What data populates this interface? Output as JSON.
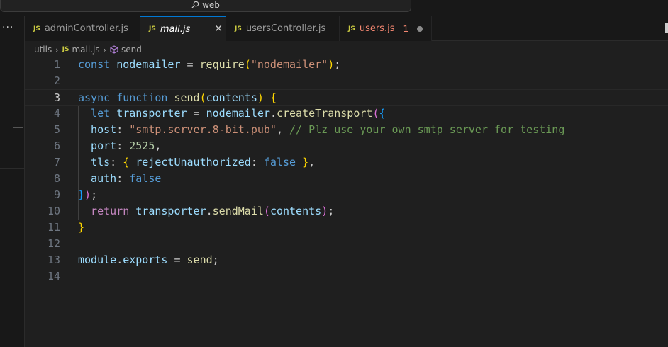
{
  "titlebar": {
    "search_text": "web"
  },
  "activity": {
    "more": "···"
  },
  "tabs": [
    {
      "label": "adminController.js",
      "icon": "JS",
      "italic": false,
      "modified": true,
      "active": false
    },
    {
      "label": "mail.js",
      "icon": "JS",
      "italic": true,
      "modified": false,
      "active": true,
      "close": "✕"
    },
    {
      "label": "usersController.js",
      "icon": "JS",
      "italic": false,
      "modified": false,
      "active": false
    },
    {
      "label": "users.js",
      "icon": "JS",
      "italic": false,
      "modified": true,
      "active": false,
      "problems": "1",
      "error": true
    }
  ],
  "breadcrumb": {
    "folder": "utils",
    "file": "mail.js",
    "symbol": "send",
    "icon": "JS"
  },
  "editor": {
    "line_numbers": [
      "1",
      "2",
      "3",
      "4",
      "5",
      "6",
      "7",
      "8",
      "9",
      "10",
      "11",
      "12",
      "13",
      "14"
    ],
    "current_line": 3,
    "tokens": [
      [
        [
          "const ",
          "kw"
        ],
        [
          "nodemailer",
          "var"
        ],
        [
          " = ",
          ""
        ],
        [
          "require",
          "fn"
        ],
        [
          "(",
          "p1"
        ],
        [
          "\"nodemailer\"",
          "str"
        ],
        [
          ")",
          "p1"
        ],
        [
          ";",
          ""
        ]
      ],
      [],
      [
        [
          "async ",
          "kw"
        ],
        [
          "function ",
          "kw"
        ],
        [
          "|",
          ""
        ],
        [
          "send",
          "fn"
        ],
        [
          "(",
          "p1"
        ],
        [
          "contents",
          "var"
        ],
        [
          ")",
          "p1"
        ],
        [
          " ",
          ""
        ],
        [
          "{",
          "p1"
        ]
      ],
      [
        [
          "  let ",
          "kw"
        ],
        [
          "transporter",
          "var"
        ],
        [
          " = ",
          ""
        ],
        [
          "nodemailer",
          "var"
        ],
        [
          ".",
          ""
        ],
        [
          "createTransport",
          "fn"
        ],
        [
          "(",
          "p2"
        ],
        [
          "{",
          "p3"
        ]
      ],
      [
        [
          "  host",
          "var"
        ],
        [
          ": ",
          ""
        ],
        [
          "\"smtp.server.8-bit.pub\"",
          "str"
        ],
        [
          ", ",
          ""
        ],
        [
          "// Plz use your own smtp server for testing",
          "com"
        ]
      ],
      [
        [
          "  port",
          "var"
        ],
        [
          ": ",
          ""
        ],
        [
          "2525",
          "num"
        ],
        [
          ",",
          ""
        ]
      ],
      [
        [
          "  tls",
          "var"
        ],
        [
          ": ",
          ""
        ],
        [
          "{",
          "p1"
        ],
        [
          " ",
          ""
        ],
        [
          "rejectUnauthorized",
          "var"
        ],
        [
          ": ",
          ""
        ],
        [
          "false",
          "kw"
        ],
        [
          " ",
          ""
        ],
        [
          "}",
          "p1"
        ],
        [
          ",",
          ""
        ]
      ],
      [
        [
          "  auth",
          "var"
        ],
        [
          ": ",
          ""
        ],
        [
          "false",
          "kw"
        ]
      ],
      [
        [
          "}",
          "p3"
        ],
        [
          ")",
          "p2"
        ],
        [
          ";",
          ""
        ]
      ],
      [
        [
          "  return ",
          "kw2"
        ],
        [
          "transporter",
          "var"
        ],
        [
          ".",
          ""
        ],
        [
          "sendMail",
          "fn"
        ],
        [
          "(",
          "p2"
        ],
        [
          "contents",
          "var"
        ],
        [
          ")",
          "p2"
        ],
        [
          ";",
          ""
        ]
      ],
      [
        [
          "}",
          "p1"
        ]
      ],
      [],
      [
        [
          "module",
          "var"
        ],
        [
          ".",
          ""
        ],
        [
          "exports",
          "var"
        ],
        [
          " = ",
          ""
        ],
        [
          "send",
          "fn"
        ],
        [
          ";",
          ""
        ]
      ],
      []
    ]
  }
}
